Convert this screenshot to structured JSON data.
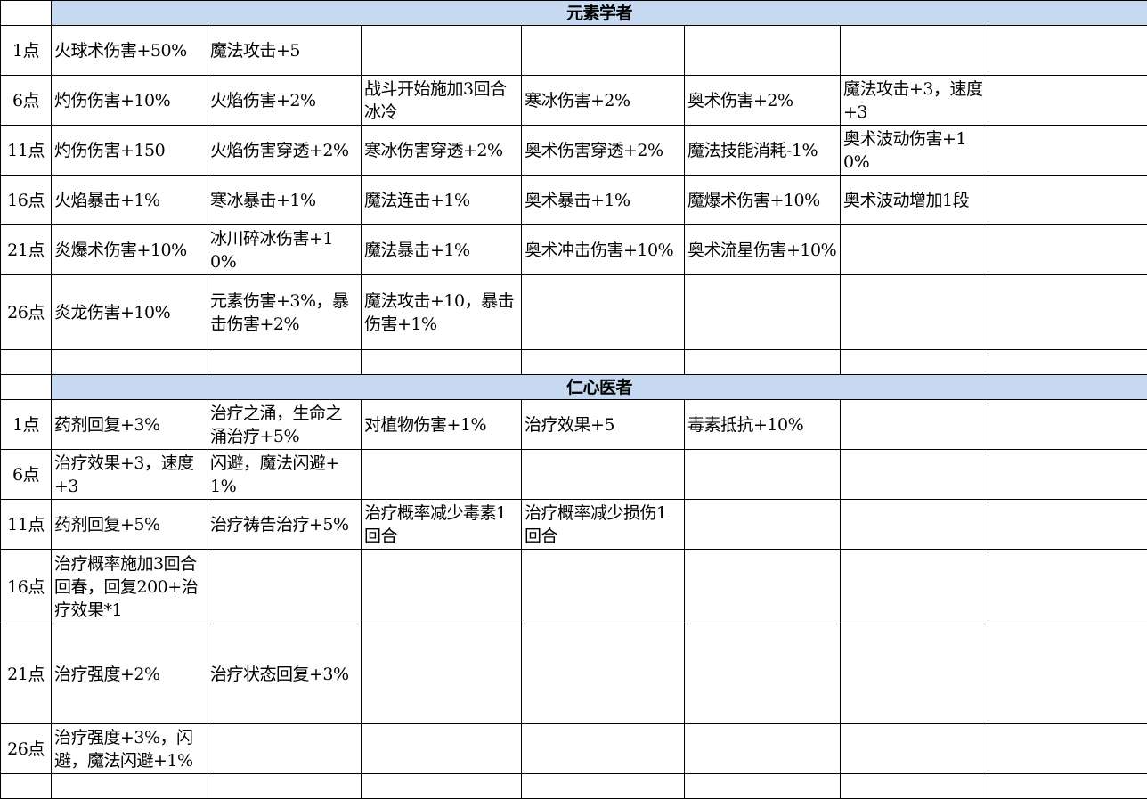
{
  "sections": [
    {
      "title": "元素学者",
      "rows": [
        {
          "level": "1点",
          "cells": [
            "火球术伤害+50%",
            "魔法攻击+5",
            "",
            "",
            "",
            "",
            ""
          ]
        },
        {
          "level": "6点",
          "cells": [
            "灼伤伤害+10%",
            "火焰伤害+2%",
            "战斗开始施加3回合冰冷",
            "寒冰伤害+2%",
            "奥术伤害+2%",
            "魔法攻击+3，速度+3",
            ""
          ]
        },
        {
          "level": "11点",
          "cells": [
            "灼伤伤害+150",
            "火焰伤害穿透+2%",
            "寒冰伤害穿透+2%",
            "奥术伤害穿透+2%",
            "魔法技能消耗-1%",
            "奥术波动伤害+10%",
            ""
          ]
        },
        {
          "level": "16点",
          "cells": [
            "火焰暴击+1%",
            "寒冰暴击+1%",
            "魔法连击+1%",
            "奥术暴击+1%",
            "魔爆术伤害+10%",
            "奥术波动增加1段",
            ""
          ]
        },
        {
          "level": "21点",
          "cells": [
            "炎爆术伤害+10%",
            "冰川碎冰伤害+10%",
            "魔法暴击+1%",
            "奥术冲击伤害+10%",
            "奥术流星伤害+10%",
            "",
            ""
          ]
        },
        {
          "level": "26点",
          "cells": [
            "炎龙伤害+10%",
            "元素伤害+3%，暴击伤害+2%",
            "魔法攻击+10，暴击伤害+1%",
            "",
            "",
            "",
            ""
          ]
        }
      ]
    },
    {
      "title": "仁心医者",
      "rows": [
        {
          "level": "1点",
          "cells": [
            "药剂回复+3%",
            "治疗之涌，生命之涌治疗+5%",
            "对植物伤害+1%",
            "治疗效果+5",
            "毒素抵抗+10%",
            "",
            ""
          ]
        },
        {
          "level": "6点",
          "cells": [
            "治疗效果+3，速度+3",
            "闪避，魔法闪避+1%",
            "",
            "",
            "",
            "",
            ""
          ]
        },
        {
          "level": "11点",
          "cells": [
            "药剂回复+5%",
            "治疗祷告治疗+5%",
            "治疗概率减少毒素1回合",
            "治疗概率减少损伤1回合",
            "",
            "",
            ""
          ]
        },
        {
          "level": "16点",
          "cells": [
            "治疗概率施加3回合回春，回复200+治疗效果*1",
            "",
            "",
            "",
            "",
            "",
            ""
          ]
        },
        {
          "level": "21点",
          "cells": [
            "治疗强度+2%",
            "治疗状态回复+3%",
            "",
            "",
            "",
            "",
            ""
          ]
        },
        {
          "level": "26点",
          "cells": [
            "治疗强度+3%，闪避，魔法闪避+1%",
            "",
            "",
            "",
            "",
            "",
            ""
          ]
        }
      ]
    }
  ]
}
